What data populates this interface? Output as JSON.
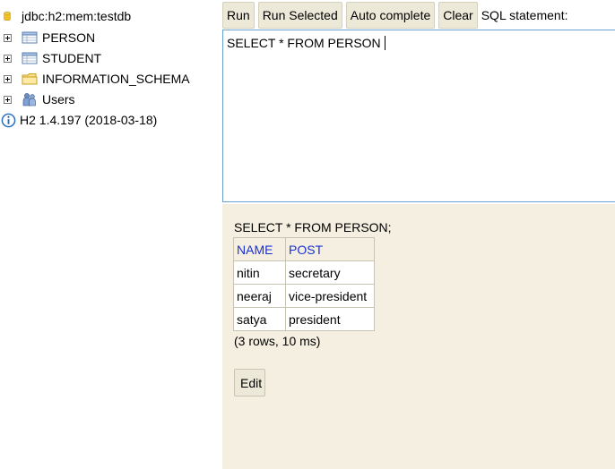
{
  "tree": {
    "connection": "jdbc:h2:mem:testdb",
    "tables": [
      "PERSON",
      "STUDENT"
    ],
    "schema": "INFORMATION_SCHEMA",
    "users": "Users",
    "version": "H2 1.4.197 (2018-03-18)"
  },
  "toolbar": {
    "run": "Run",
    "run_selected": "Run Selected",
    "auto_complete": "Auto complete",
    "clear": "Clear",
    "sql_label": "SQL statement:"
  },
  "editor": {
    "value": "SELECT * FROM PERSON"
  },
  "result": {
    "query": "SELECT * FROM PERSON;",
    "columns": [
      "NAME",
      "POST"
    ],
    "rows": [
      [
        "nitin",
        "secretary"
      ],
      [
        "neeraj",
        "vice-president"
      ],
      [
        "satya",
        "president"
      ]
    ],
    "summary": "(3 rows, 10 ms)",
    "edit_label": "Edit"
  },
  "colors": {
    "result_bg": "#f4efe1",
    "button_bg": "#ece9d8",
    "header_text": "#1a2fd6",
    "editor_border": "#6a9fd4"
  }
}
